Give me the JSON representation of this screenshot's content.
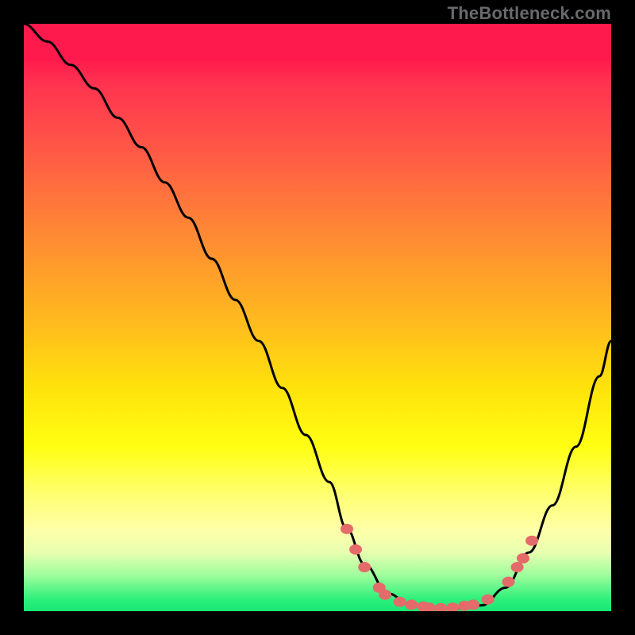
{
  "watermark": {
    "text": "TheBottleneck.com"
  },
  "chart_data": {
    "type": "line",
    "title": "",
    "xlabel": "",
    "ylabel": "",
    "xlim": [
      0,
      100
    ],
    "ylim": [
      0,
      100
    ],
    "grid": false,
    "legend": false,
    "series": [
      {
        "name": "bottleneck-curve",
        "x": [
          0,
          4,
          8,
          12,
          16,
          20,
          24,
          28,
          32,
          36,
          40,
          44,
          48,
          52,
          55,
          58,
          62,
          66,
          70,
          74,
          78,
          82,
          86,
          90,
          94,
          98,
          100
        ],
        "y": [
          100,
          97,
          93,
          89,
          84,
          79,
          73,
          67,
          60,
          53,
          46,
          38,
          30,
          22,
          14,
          8,
          3,
          1,
          0.5,
          0.5,
          1,
          4,
          10,
          18,
          28,
          40,
          46
        ],
        "color": "#000000"
      }
    ],
    "highlight_points": {
      "name": "bottleneck-highlight-dots",
      "color": "#e56a6a",
      "points": [
        {
          "x": 55,
          "y": 14
        },
        {
          "x": 56.5,
          "y": 10.5
        },
        {
          "x": 58,
          "y": 7.5
        },
        {
          "x": 60.5,
          "y": 4
        },
        {
          "x": 61.5,
          "y": 2.8
        },
        {
          "x": 64,
          "y": 1.6
        },
        {
          "x": 66,
          "y": 1.1
        },
        {
          "x": 68,
          "y": 0.8
        },
        {
          "x": 69,
          "y": 0.6
        },
        {
          "x": 71,
          "y": 0.5
        },
        {
          "x": 73,
          "y": 0.6
        },
        {
          "x": 75,
          "y": 0.9
        },
        {
          "x": 76.5,
          "y": 1.1
        },
        {
          "x": 79,
          "y": 2.0
        },
        {
          "x": 82.5,
          "y": 5.0
        },
        {
          "x": 84,
          "y": 7.5
        },
        {
          "x": 85,
          "y": 9.0
        },
        {
          "x": 86.5,
          "y": 12.0
        }
      ]
    },
    "background_gradient": {
      "top_color": "#ff1a4d",
      "bottom_color": "#18e876"
    }
  }
}
